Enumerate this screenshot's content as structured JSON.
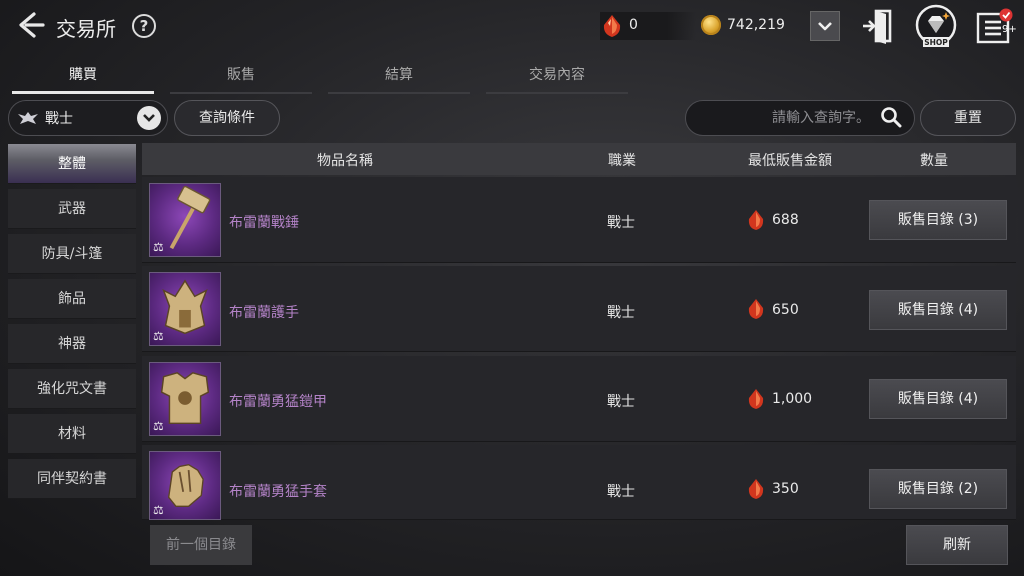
{
  "header": {
    "title": "交易所",
    "help": "?",
    "gem_balance": "0",
    "coin_balance": "742,219",
    "shop_label": "SHOP",
    "notification_badge": "9+"
  },
  "tabs": [
    {
      "label": "購買",
      "active": true
    },
    {
      "label": "販售",
      "active": false
    },
    {
      "label": "結算",
      "active": false
    },
    {
      "label": "交易內容",
      "active": false
    }
  ],
  "filters": {
    "class_selected": "戰士",
    "query_conditions_label": "查詢條件",
    "search_placeholder": "請輸入查詢字。",
    "reset_label": "重置"
  },
  "sidebar": {
    "items": [
      {
        "label": "整體",
        "active": true
      },
      {
        "label": "武器"
      },
      {
        "label": "防具/斗篷"
      },
      {
        "label": "飾品"
      },
      {
        "label": "神器"
      },
      {
        "label": "強化咒文書"
      },
      {
        "label": "材料"
      },
      {
        "label": "同伴契約書"
      }
    ]
  },
  "table": {
    "columns": [
      "物品名稱",
      "職業",
      "最低販售金額",
      "數量"
    ],
    "rows": [
      {
        "icon": "warhammer-icon",
        "name": "布雷蘭戰錘",
        "class": "戰士",
        "price": "688",
        "button": "販售目錄 (3)"
      },
      {
        "icon": "gauntlet-icon",
        "name": "布雷蘭護手",
        "class": "戰士",
        "price": "650",
        "button": "販售目錄 (4)"
      },
      {
        "icon": "armor-icon",
        "name": "布雷蘭勇猛鎧甲",
        "class": "戰士",
        "price": "1,000",
        "button": "販售目錄 (4)"
      },
      {
        "icon": "glove-icon",
        "name": "布雷蘭勇猛手套",
        "class": "戰士",
        "price": "350",
        "button": "販售目錄 (2)"
      }
    ]
  },
  "footer": {
    "prev_label": "前一個目錄",
    "refresh_label": "刷新"
  },
  "colors": {
    "accent_item_name": "#b483c8",
    "item_icon_bg": "#5d2a82",
    "gem": "#e0442a",
    "coin": "#d9a22b"
  }
}
